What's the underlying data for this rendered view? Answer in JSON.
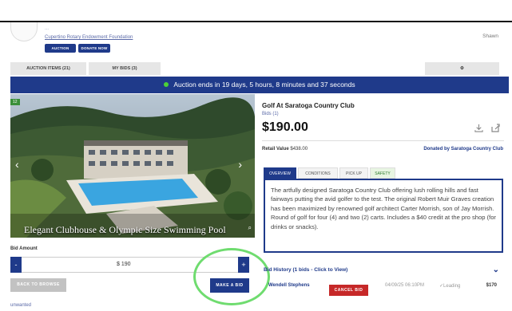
{
  "header": {
    "org_name": "...",
    "org_link": "Cupertino Rotary Endowment Foundation",
    "auction_btn": "AUCTION",
    "donate_btn": "DONATE NOW",
    "user": "Shawn"
  },
  "tabs": {
    "auction_items": "AUCTION ITEMS (21)",
    "my_bids": "MY BIDS (3)",
    "settings_icon": "gear-icon"
  },
  "banner": {
    "text": "Auction ends in 19 days, 5 hours, 8 minutes and 37 seconds"
  },
  "photo": {
    "badge": "12",
    "caption": "Elegant Clubhouse & Olympic Size Swimming Pool"
  },
  "bid_form": {
    "label": "Bid Amount",
    "minus": "-",
    "plus": "+",
    "amount": "$ 190",
    "back_btn": "BACK TO BROWSE",
    "make_bid_btn": "MAKE A BID",
    "unwanted_link": "unwanted"
  },
  "item": {
    "title": "Golf At Saratoga Country Club",
    "bids_link": "Bids (1)",
    "price": "$190.00",
    "retail_label": "Retail Value",
    "retail_value": "$438.00",
    "donated_by": "Donated by Saratoga Country Club",
    "tabs": [
      "OVERVIEW",
      "CONDITIONS",
      "PICK UP",
      "SAFETY"
    ],
    "description": "The artfully designed Saratoga Country Club offering lush rolling hills and fast fairways putting the avid golfer to the test. The original Robert Muir Graves creation has been maximized by renowned golf architect Carter Morrish, son of Jay Morrish. Round of golf for four (4) and two (2) carts. Includes a $40 credit at the pro shop (for drinks or snacks)."
  },
  "bid_history": {
    "title": "Bid History (1 bids - Click to View)",
    "rows": [
      {
        "name": "Wendell Stephens",
        "cancel": "CANCEL BID",
        "date": "04/09/25 06:10PM",
        "status": "✓Leading",
        "amount": "$170"
      }
    ]
  },
  "colors": {
    "brand": "#1f3a8a",
    "highlight": "#6fdc6f",
    "danger": "#c62828"
  }
}
